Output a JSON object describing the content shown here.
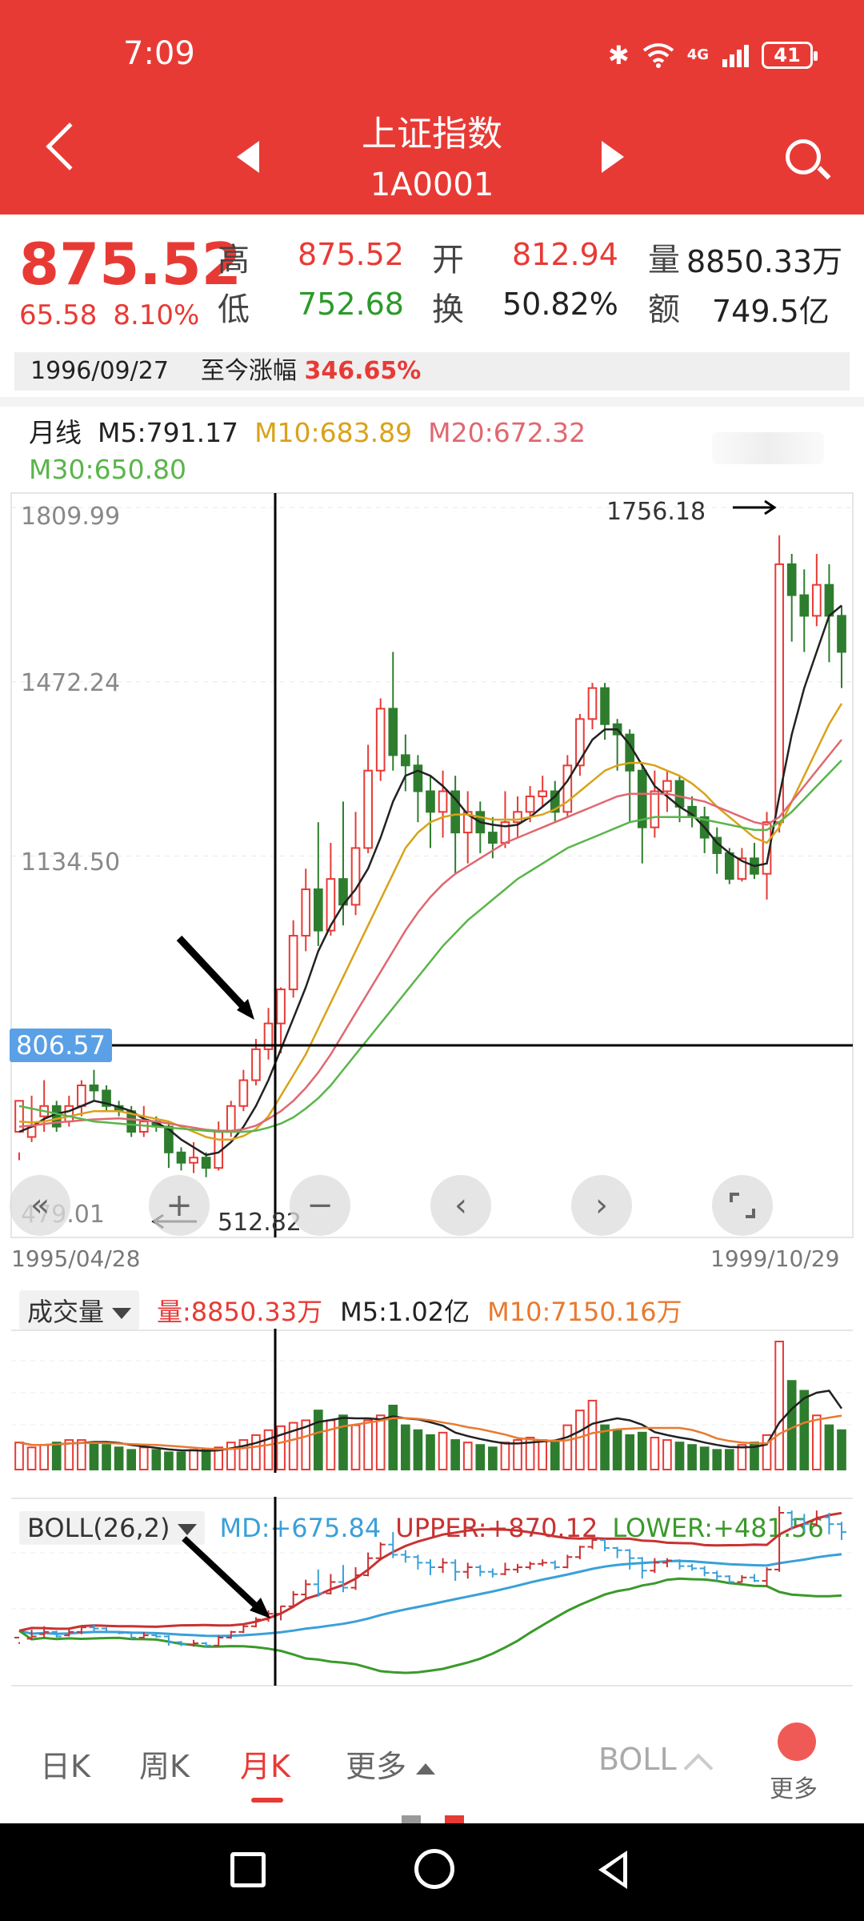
{
  "status_bar": {
    "time": "7:09",
    "network": "4G",
    "battery": "41"
  },
  "header": {
    "title": "上证指数",
    "code": "1A0001"
  },
  "quote": {
    "price": "875.52",
    "change": "65.58",
    "change_pct": "8.10%",
    "high_label": "高",
    "high": "875.52",
    "low_label": "低",
    "low": "752.68",
    "open_label": "开",
    "open": "812.94",
    "turnover_label": "换",
    "turnover": "50.82%",
    "volume_label": "量",
    "volume": "8850.33万",
    "amount_label": "额",
    "amount": "749.5亿",
    "date": "1996/09/27",
    "since_label": "至今涨幅",
    "since_value": "346.65%"
  },
  "ma_legend": {
    "period": "月线",
    "m5": "M5:791.17",
    "m10": "M10:683.89",
    "m20": "M20:672.32",
    "m30": "M30:650.80"
  },
  "price_chart": {
    "y_ticks": [
      "1809.99",
      "1472.24",
      "1134.50",
      "479.01"
    ],
    "crosshair_value": "806.57",
    "max_label": "1756.18",
    "min_label": "512.82",
    "date_start": "1995/04/28",
    "date_end": "1999/10/29"
  },
  "controls": {
    "zoom_out": "−",
    "zoom_in": "+"
  },
  "volume_panel": {
    "selector": "成交量",
    "vol": "量:8850.33万",
    "m5": "M5:1.02亿",
    "m10": "M10:7150.16万"
  },
  "boll_panel": {
    "selector": "BOLL(26,2)",
    "md": "MD:+675.84",
    "upper": "UPPER:+870.12",
    "lower": "LOWER:+481.56"
  },
  "tabs": [
    {
      "label": "日K",
      "active": false
    },
    {
      "label": "周K",
      "active": false
    },
    {
      "label": "月K",
      "active": true
    },
    {
      "label": "更多",
      "active": false
    }
  ],
  "indicator_selector": "BOLL",
  "more_label": "更多",
  "colors": {
    "header": "#e83a35",
    "up": "#e83a35",
    "down": "#2e7d2e",
    "m5": "#222222",
    "m10": "#d9a21a",
    "m20": "#e06870",
    "m30": "#5ab54a",
    "md": "#3aa0d8",
    "upper": "#c83232",
    "lower": "#3a9a2a"
  },
  "chart_data": {
    "type": "candlestick",
    "x_range": [
      "1995/04/28",
      "1999/10/29"
    ],
    "y_ticks": [
      1809.99,
      1472.24,
      1134.5,
      479.01
    ],
    "ohlc": [
      [
        600,
        660,
        560,
        545
      ],
      [
        590,
        610,
        670,
        580
      ],
      [
        630,
        650,
        700,
        600
      ],
      [
        650,
        610,
        660,
        600
      ],
      [
        620,
        650,
        670,
        610
      ],
      [
        650,
        690,
        700,
        630
      ],
      [
        690,
        680,
        720,
        660
      ],
      [
        680,
        650,
        690,
        640
      ],
      [
        650,
        640,
        660,
        630
      ],
      [
        640,
        600,
        650,
        590
      ],
      [
        600,
        620,
        650,
        590
      ],
      [
        620,
        610,
        630,
        600
      ],
      [
        610,
        560,
        620,
        530
      ],
      [
        560,
        540,
        570,
        525
      ],
      [
        540,
        550,
        580,
        520
      ],
      [
        550,
        530,
        560,
        512
      ],
      [
        530,
        600,
        620,
        525
      ],
      [
        600,
        650,
        660,
        590
      ],
      [
        650,
        700,
        720,
        640
      ],
      [
        700,
        760,
        780,
        690
      ],
      [
        760,
        810,
        840,
        740
      ],
      [
        810,
        876,
        880,
        752
      ],
      [
        876,
        980,
        1010,
        860
      ],
      [
        980,
        1070,
        1110,
        950
      ],
      [
        1070,
        990,
        1200,
        960
      ],
      [
        990,
        1090,
        1160,
        980
      ],
      [
        1090,
        1040,
        1240,
        1000
      ],
      [
        1040,
        1150,
        1220,
        1020
      ],
      [
        1150,
        1300,
        1350,
        1140
      ],
      [
        1300,
        1420,
        1440,
        1280
      ],
      [
        1420,
        1330,
        1530,
        1300
      ],
      [
        1330,
        1310,
        1370,
        1260
      ],
      [
        1310,
        1260,
        1330,
        1200
      ],
      [
        1260,
        1220,
        1290,
        1150
      ],
      [
        1220,
        1260,
        1300,
        1170
      ],
      [
        1260,
        1180,
        1290,
        1100
      ],
      [
        1180,
        1220,
        1260,
        1120
      ],
      [
        1220,
        1180,
        1240,
        1140
      ],
      [
        1180,
        1160,
        1210,
        1130
      ],
      [
        1160,
        1200,
        1260,
        1150
      ],
      [
        1200,
        1220,
        1250,
        1170
      ],
      [
        1220,
        1250,
        1270,
        1200
      ],
      [
        1250,
        1260,
        1290,
        1230
      ],
      [
        1260,
        1220,
        1280,
        1200
      ],
      [
        1220,
        1310,
        1330,
        1210
      ],
      [
        1310,
        1400,
        1410,
        1290
      ],
      [
        1400,
        1460,
        1470,
        1380
      ],
      [
        1460,
        1390,
        1470,
        1360
      ],
      [
        1390,
        1370,
        1400,
        1300
      ],
      [
        1370,
        1300,
        1380,
        1200
      ],
      [
        1300,
        1190,
        1310,
        1120
      ],
      [
        1190,
        1260,
        1300,
        1170
      ],
      [
        1260,
        1280,
        1300,
        1220
      ],
      [
        1280,
        1230,
        1290,
        1200
      ],
      [
        1230,
        1210,
        1250,
        1190
      ],
      [
        1210,
        1170,
        1230,
        1140
      ],
      [
        1170,
        1140,
        1190,
        1100
      ],
      [
        1140,
        1090,
        1150,
        1080
      ],
      [
        1090,
        1130,
        1150,
        1085
      ],
      [
        1130,
        1100,
        1160,
        1090
      ],
      [
        1100,
        1200,
        1220,
        1050
      ],
      [
        1200,
        1700,
        1756,
        1180
      ],
      [
        1700,
        1640,
        1720,
        1550
      ],
      [
        1640,
        1600,
        1690,
        1530
      ],
      [
        1600,
        1660,
        1720,
        1580
      ],
      [
        1660,
        1600,
        1700,
        1510
      ],
      [
        1600,
        1530,
        1620,
        1460
      ]
    ],
    "volume": [
      0.55,
      0.45,
      0.5,
      0.55,
      0.6,
      0.6,
      0.55,
      0.5,
      0.45,
      0.4,
      0.45,
      0.4,
      0.35,
      0.35,
      0.4,
      0.4,
      0.45,
      0.55,
      0.6,
      0.7,
      0.8,
      0.88,
      0.95,
      1.0,
      1.2,
      1.0,
      1.1,
      0.9,
      1.0,
      1.1,
      1.3,
      0.9,
      0.8,
      0.7,
      0.75,
      0.6,
      0.55,
      0.5,
      0.45,
      0.55,
      0.6,
      0.65,
      0.6,
      0.55,
      0.9,
      1.2,
      1.4,
      0.9,
      0.8,
      0.7,
      0.75,
      0.65,
      0.6,
      0.55,
      0.5,
      0.45,
      0.4,
      0.4,
      0.5,
      0.55,
      0.7,
      2.6,
      1.8,
      1.6,
      1.1,
      0.9,
      0.8
    ],
    "ma": {
      "M5": [
        600,
        610,
        625,
        635,
        640,
        650,
        660,
        655,
        648,
        640,
        625,
        618,
        605,
        585,
        570,
        555,
        560,
        580,
        610,
        650,
        700,
        760,
        820,
        880,
        950,
        1000,
        1040,
        1070,
        1110,
        1170,
        1240,
        1290,
        1300,
        1290,
        1270,
        1245,
        1215,
        1200,
        1195,
        1192,
        1195,
        1210,
        1230,
        1250,
        1280,
        1320,
        1360,
        1380,
        1380,
        1350,
        1310,
        1270,
        1250,
        1230,
        1215,
        1190,
        1160,
        1140,
        1125,
        1115,
        1120,
        1250,
        1370,
        1460,
        1530,
        1600,
        1620
      ],
      "M10": [
        620,
        618,
        620,
        625,
        630,
        635,
        640,
        640,
        640,
        635,
        630,
        625,
        620,
        610,
        600,
        590,
        585,
        585,
        592,
        605,
        630,
        670,
        710,
        750,
        800,
        850,
        900,
        950,
        1000,
        1050,
        1100,
        1150,
        1180,
        1200,
        1210,
        1215,
        1215,
        1210,
        1205,
        1205,
        1205,
        1210,
        1215,
        1225,
        1240,
        1260,
        1280,
        1300,
        1310,
        1315,
        1315,
        1310,
        1300,
        1290,
        1275,
        1255,
        1230,
        1210,
        1190,
        1170,
        1160,
        1190,
        1240,
        1290,
        1340,
        1390,
        1430
      ],
      "M20": [
        610,
        612,
        615,
        618,
        620,
        622,
        624,
        625,
        626,
        624,
        622,
        620,
        616,
        612,
        608,
        604,
        602,
        602,
        605,
        612,
        625,
        640,
        660,
        685,
        715,
        750,
        790,
        830,
        870,
        910,
        950,
        990,
        1025,
        1055,
        1080,
        1100,
        1115,
        1130,
        1145,
        1160,
        1170,
        1180,
        1190,
        1200,
        1210,
        1220,
        1230,
        1240,
        1250,
        1255,
        1255,
        1255,
        1255,
        1250,
        1245,
        1240,
        1230,
        1220,
        1210,
        1200,
        1195,
        1210,
        1240,
        1270,
        1300,
        1330,
        1360
      ],
      "M30": [
        650,
        645,
        640,
        635,
        630,
        625,
        620,
        618,
        616,
        614,
        612,
        610,
        608,
        606,
        604,
        602,
        600,
        600,
        600,
        602,
        608,
        616,
        628,
        645,
        665,
        690,
        720,
        750,
        780,
        810,
        840,
        870,
        900,
        930,
        960,
        985,
        1010,
        1030,
        1050,
        1070,
        1090,
        1105,
        1120,
        1135,
        1150,
        1160,
        1170,
        1180,
        1190,
        1200,
        1205,
        1210,
        1210,
        1210,
        1210,
        1205,
        1200,
        1195,
        1190,
        1185,
        1185,
        1200,
        1220,
        1245,
        1270,
        1295,
        1320
      ]
    },
    "boll": {
      "md": 675.84,
      "upper": 870.12,
      "lower": 481.56
    }
  }
}
